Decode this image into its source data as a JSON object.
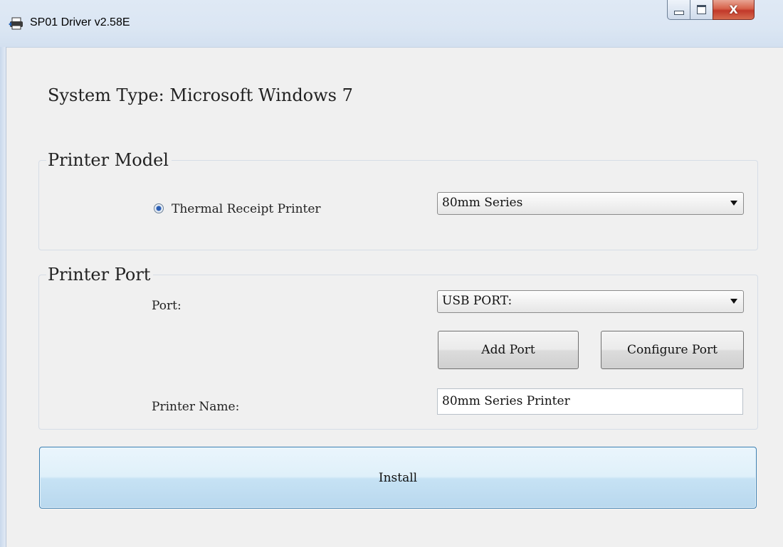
{
  "window": {
    "title": "SP01 Driver v2.58E"
  },
  "system": {
    "text": "System Type: Microsoft Windows 7"
  },
  "printer_model": {
    "label": "Printer Model",
    "radio_label": "Thermal Receipt Printer",
    "series_selected": "80mm Series"
  },
  "printer_port": {
    "label": "Printer Port",
    "port_label": "Port:",
    "port_selected": "USB PORT:",
    "add_port": "Add Port",
    "configure_port": "Configure Port",
    "printer_name_label": "Printer Name:",
    "printer_name_value": "80mm Series Printer"
  },
  "install": {
    "label": "Install"
  },
  "caption": {
    "close_glyph": "X"
  }
}
